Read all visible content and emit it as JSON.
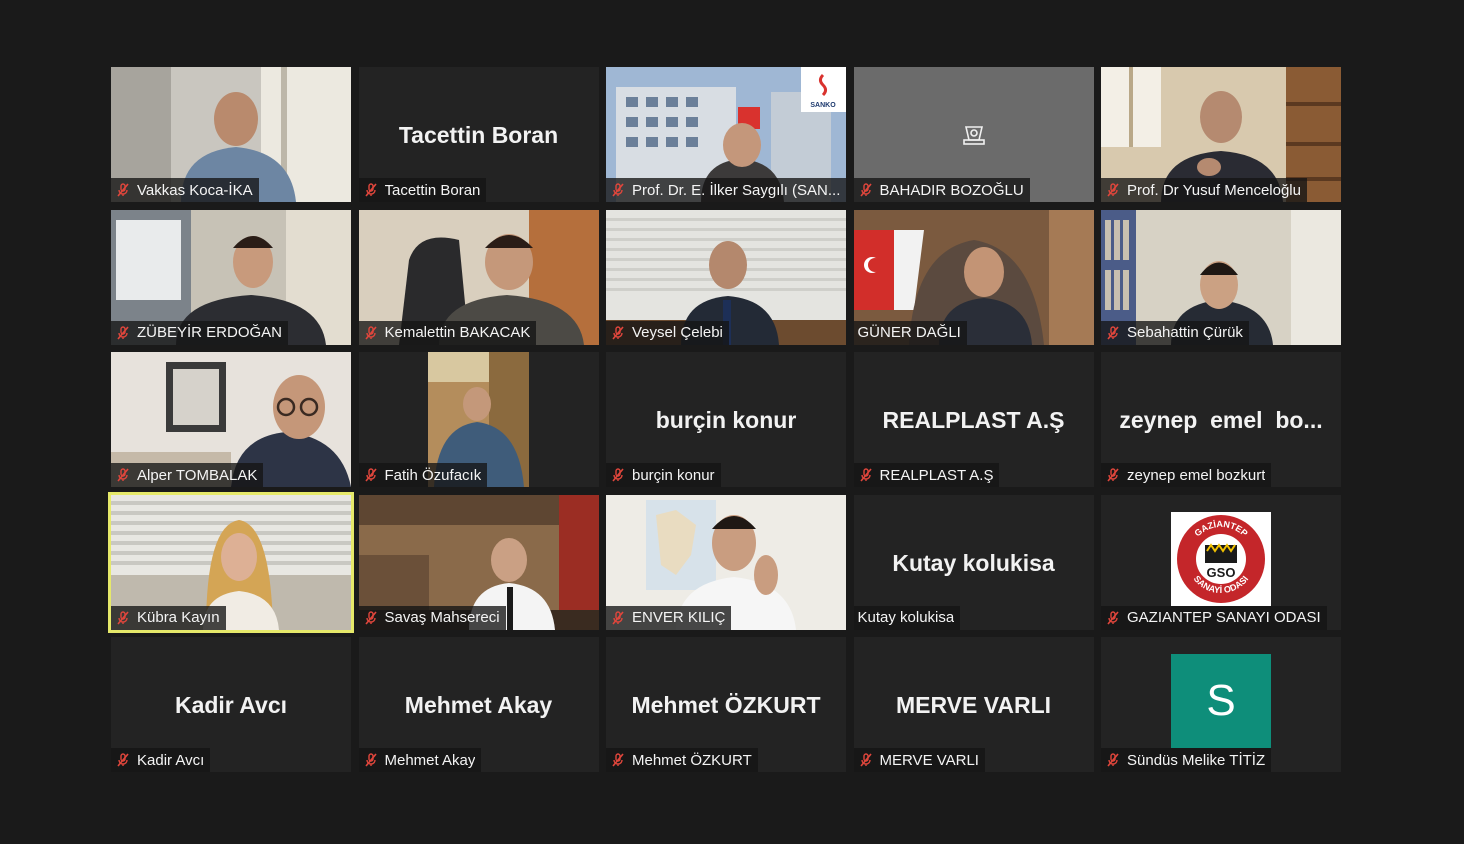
{
  "participants": [
    {
      "display_name": "Vakkas Koca-İKA",
      "video": true,
      "muted": true
    },
    {
      "display_name": "Tacettin Boran",
      "big_name": "Tacettin Boran",
      "video": false,
      "muted": true
    },
    {
      "display_name": "Prof. Dr. E. İlker Saygılı (SAN...",
      "video": true,
      "muted": true,
      "logo_text": "SANKO"
    },
    {
      "display_name": "BAHADIR BOZOĞLU",
      "video": false,
      "muted": true
    },
    {
      "display_name": "Prof. Dr Yusuf Menceloğlu",
      "video": true,
      "muted": true
    },
    {
      "display_name": "ZÜBEYİR ERDOĞAN",
      "video": true,
      "muted": true
    },
    {
      "display_name": "Kemalettin BAKACAK",
      "video": true,
      "muted": true
    },
    {
      "display_name": "Veysel Çelebi",
      "video": true,
      "muted": true
    },
    {
      "display_name": "GÜNER DAĞLI",
      "video": true,
      "muted": false
    },
    {
      "display_name": "Sebahattin Çürük",
      "video": true,
      "muted": true
    },
    {
      "display_name": "Alper TOMBALAK",
      "video": true,
      "muted": true
    },
    {
      "display_name": "Fatih Özufacık",
      "video": true,
      "muted": true
    },
    {
      "display_name": "burçin konur",
      "big_name": "burçin konur",
      "video": false,
      "muted": true
    },
    {
      "display_name": "REALPLAST A.Ş",
      "big_name": "REALPLAST A.Ş",
      "video": false,
      "muted": true
    },
    {
      "display_name": "zeynep emel bozkurt",
      "big_name": "zeynep  emel  bo...",
      "video": false,
      "muted": true
    },
    {
      "display_name": "Kübra Kayın",
      "video": true,
      "muted": true,
      "active_speaker": true
    },
    {
      "display_name": "Savaş Mahsereci",
      "video": true,
      "muted": true
    },
    {
      "display_name": "ENVER KILIÇ",
      "video": true,
      "muted": true
    },
    {
      "display_name": "Kutay kolukisa",
      "big_name": "Kutay kolukisa",
      "video": false,
      "muted": false
    },
    {
      "display_name": "GAZIANTEP SANAYI ODASI",
      "video": false,
      "muted": true,
      "logo": "GSO",
      "logo_ring_top": "GAZİANTEP",
      "logo_ring_bottom": "SANAYİ ODASI"
    },
    {
      "display_name": "Kadir Avcı",
      "big_name": "Kadir Avcı",
      "video": false,
      "muted": true
    },
    {
      "display_name": "Mehmet Akay",
      "big_name": "Mehmet Akay",
      "video": false,
      "muted": true
    },
    {
      "display_name": "Mehmet ÖZKURT",
      "big_name": "Mehmet ÖZKURT",
      "video": false,
      "muted": true
    },
    {
      "display_name": "MERVE VARLI",
      "big_name": "MERVE VARLI",
      "video": false,
      "muted": true
    },
    {
      "display_name": "Sündüs Melike TİTİZ",
      "avatar_letter": "S",
      "video": false,
      "muted": true
    }
  ],
  "colors": {
    "background": "#1a1a1a",
    "tile": "#232323",
    "active_speaker_border": "#e6e96a",
    "muted_icon": "#e0463c",
    "avatar": "#0e8e7a"
  },
  "icons": {
    "muted": "mic-muted-icon",
    "camera_off": "camera-off-icon"
  }
}
